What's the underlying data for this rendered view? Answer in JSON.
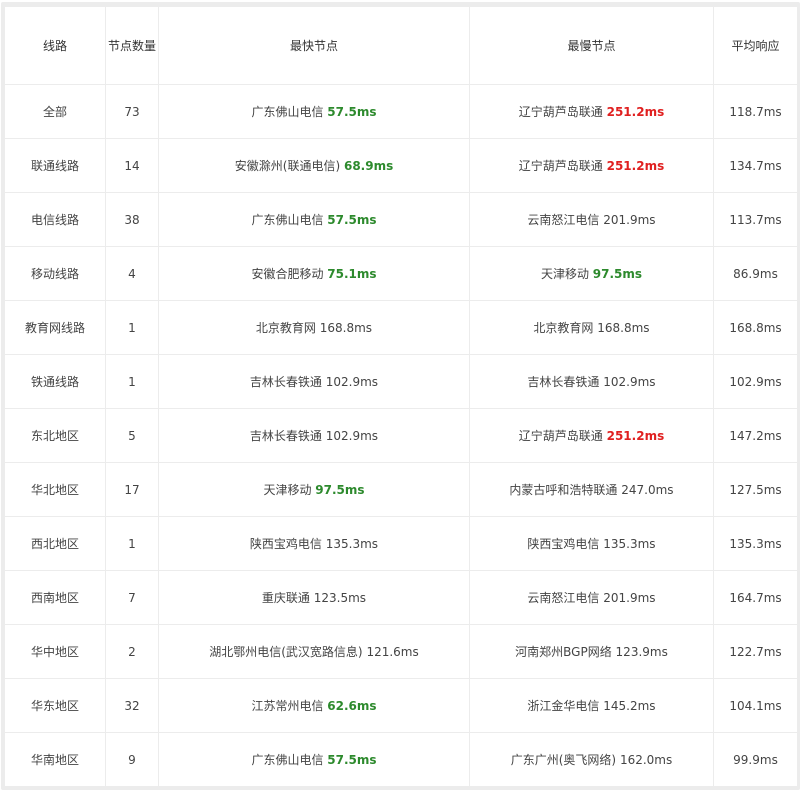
{
  "headers": [
    "线路",
    "节点数量",
    "最快节点",
    "最慢节点",
    "平均响应"
  ],
  "rows": [
    {
      "line": "全部",
      "count": "73",
      "fast_name": "广东佛山电信",
      "fast_ms": "57.5ms",
      "fast_hl": "fast",
      "slow_name": "辽宁葫芦岛联通",
      "slow_ms": "251.2ms",
      "slow_hl": "slow",
      "avg": "118.7ms"
    },
    {
      "line": "联通线路",
      "count": "14",
      "fast_name": "安徽滁州(联通电信)",
      "fast_ms": "68.9ms",
      "fast_hl": "fast",
      "slow_name": "辽宁葫芦岛联通",
      "slow_ms": "251.2ms",
      "slow_hl": "slow",
      "avg": "134.7ms"
    },
    {
      "line": "电信线路",
      "count": "38",
      "fast_name": "广东佛山电信",
      "fast_ms": "57.5ms",
      "fast_hl": "fast",
      "slow_name": "云南怒江电信",
      "slow_ms": "201.9ms",
      "slow_hl": "plain",
      "avg": "113.7ms"
    },
    {
      "line": "移动线路",
      "count": "4",
      "fast_name": "安徽合肥移动",
      "fast_ms": "75.1ms",
      "fast_hl": "fast",
      "slow_name": "天津移动",
      "slow_ms": "97.5ms",
      "slow_hl": "fast",
      "avg": "86.9ms"
    },
    {
      "line": "教育网线路",
      "count": "1",
      "fast_name": "北京教育网",
      "fast_ms": "168.8ms",
      "fast_hl": "plain",
      "slow_name": "北京教育网",
      "slow_ms": "168.8ms",
      "slow_hl": "plain",
      "avg": "168.8ms"
    },
    {
      "line": "铁通线路",
      "count": "1",
      "fast_name": "吉林长春铁通",
      "fast_ms": "102.9ms",
      "fast_hl": "plain",
      "slow_name": "吉林长春铁通",
      "slow_ms": "102.9ms",
      "slow_hl": "plain",
      "avg": "102.9ms"
    },
    {
      "line": "东北地区",
      "count": "5",
      "fast_name": "吉林长春铁通",
      "fast_ms": "102.9ms",
      "fast_hl": "plain",
      "slow_name": "辽宁葫芦岛联通",
      "slow_ms": "251.2ms",
      "slow_hl": "slow",
      "avg": "147.2ms"
    },
    {
      "line": "华北地区",
      "count": "17",
      "fast_name": "天津移动",
      "fast_ms": "97.5ms",
      "fast_hl": "fast",
      "slow_name": "内蒙古呼和浩特联通",
      "slow_ms": "247.0ms",
      "slow_hl": "plain",
      "avg": "127.5ms"
    },
    {
      "line": "西北地区",
      "count": "1",
      "fast_name": "陕西宝鸡电信",
      "fast_ms": "135.3ms",
      "fast_hl": "plain",
      "slow_name": "陕西宝鸡电信",
      "slow_ms": "135.3ms",
      "slow_hl": "plain",
      "avg": "135.3ms"
    },
    {
      "line": "西南地区",
      "count": "7",
      "fast_name": "重庆联通",
      "fast_ms": "123.5ms",
      "fast_hl": "plain",
      "slow_name": "云南怒江电信",
      "slow_ms": "201.9ms",
      "slow_hl": "plain",
      "avg": "164.7ms"
    },
    {
      "line": "华中地区",
      "count": "2",
      "fast_name": "湖北鄂州电信(武汉宽路信息)",
      "fast_ms": "121.6ms",
      "fast_hl": "plain",
      "slow_name": "河南郑州BGP网络",
      "slow_ms": "123.9ms",
      "slow_hl": "plain",
      "avg": "122.7ms"
    },
    {
      "line": "华东地区",
      "count": "32",
      "fast_name": "江苏常州电信",
      "fast_ms": "62.6ms",
      "fast_hl": "fast",
      "slow_name": "浙江金华电信",
      "slow_ms": "145.2ms",
      "slow_hl": "plain",
      "avg": "104.1ms"
    },
    {
      "line": "华南地区",
      "count": "9",
      "fast_name": "广东佛山电信",
      "fast_ms": "57.5ms",
      "fast_hl": "fast",
      "slow_name": "广东广州(奥飞网络)",
      "slow_ms": "162.0ms",
      "slow_hl": "plain",
      "avg": "99.9ms"
    }
  ],
  "colors": {
    "fast": "#2d8a2d",
    "slow": "#e02020",
    "text": "#444444",
    "border": "#ececec"
  }
}
